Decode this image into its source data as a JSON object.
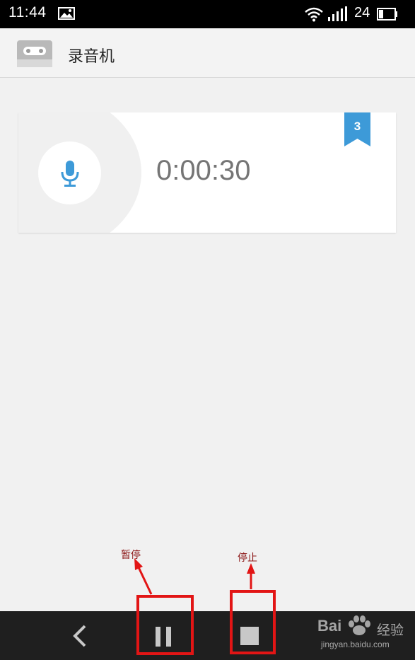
{
  "status_bar": {
    "time": "11:44",
    "battery_level": "24",
    "icons": [
      "picture-icon",
      "wifi-icon",
      "signal-icon",
      "battery-icon"
    ]
  },
  "header": {
    "app_icon": "cassette-icon",
    "title": "录音机"
  },
  "recording": {
    "elapsed": "0:00:30",
    "badge_count": "3",
    "icon": "microphone-icon",
    "accent_color": "#3d9ad8"
  },
  "nav_bar": {
    "buttons": [
      "back-icon",
      "pause-icon",
      "stop-icon"
    ]
  },
  "annotations": {
    "pause_label": "暂停",
    "stop_label": "停止",
    "highlight_color": "#e21515"
  },
  "watermark": {
    "brand": "Bai",
    "jingyan": "经验",
    "url": "jingyan.baidu.com"
  }
}
